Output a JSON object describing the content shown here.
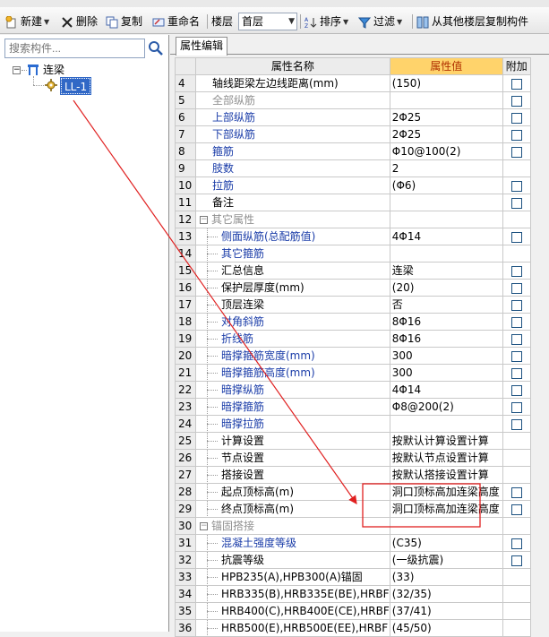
{
  "toolbar": {
    "items": [
      {
        "label": "新建",
        "icon": "new-icon"
      },
      {
        "label": "删除",
        "icon": "delete-icon"
      },
      {
        "label": "复制",
        "icon": "copy-icon"
      },
      {
        "label": "重命名",
        "icon": "rename-icon"
      },
      {
        "label": "楼层",
        "icon": ""
      },
      {
        "label": "排序",
        "icon": "sort-icon"
      },
      {
        "label": "过滤",
        "icon": "filter-icon"
      },
      {
        "label": "从其他楼层复制构件",
        "icon": "copy-floor-icon"
      }
    ],
    "floor_value": "首层"
  },
  "search": {
    "placeholder": "搜索构件..."
  },
  "tree": {
    "root": "连梁",
    "child": "LL-1"
  },
  "tab": {
    "label": "属性编辑"
  },
  "grid": {
    "headers": {
      "name": "属性名称",
      "value": "属性值",
      "extra": "附加"
    },
    "rows": [
      {
        "n": "4",
        "name": "轴线距梁左边线距离(mm)",
        "value": "(150)",
        "style": "normal",
        "indent": "1",
        "check": true
      },
      {
        "n": "5",
        "name": "全部纵筋",
        "value": "",
        "style": "gray",
        "indent": "1",
        "check": true
      },
      {
        "n": "6",
        "name": "上部纵筋",
        "value": "2Φ25",
        "style": "blue",
        "indent": "1",
        "check": true
      },
      {
        "n": "7",
        "name": "下部纵筋",
        "value": "2Φ25",
        "style": "blue",
        "indent": "1",
        "check": true
      },
      {
        "n": "8",
        "name": "箍筋",
        "value": "Φ10@100(2)",
        "style": "blue",
        "indent": "1",
        "check": true
      },
      {
        "n": "9",
        "name": "肢数",
        "value": "2",
        "style": "blue",
        "indent": "1",
        "check": false
      },
      {
        "n": "10",
        "name": "拉筋",
        "value": "(Φ6)",
        "style": "blue",
        "indent": "1",
        "check": true
      },
      {
        "n": "11",
        "name": "备注",
        "value": "",
        "style": "normal",
        "indent": "1",
        "check": true
      },
      {
        "n": "12",
        "name": "其它属性",
        "value": "",
        "style": "group",
        "indent": "0",
        "check": false
      },
      {
        "n": "13",
        "name": "侧面纵筋(总配筋值)",
        "value": "4Φ14",
        "style": "blue",
        "indent": "2",
        "check": true
      },
      {
        "n": "14",
        "name": "其它箍筋",
        "value": "",
        "style": "blue",
        "indent": "2",
        "check": false
      },
      {
        "n": "15",
        "name": "汇总信息",
        "value": "连梁",
        "style": "normal",
        "indent": "2",
        "check": true
      },
      {
        "n": "16",
        "name": "保护层厚度(mm)",
        "value": "(20)",
        "style": "normal",
        "indent": "2",
        "check": true
      },
      {
        "n": "17",
        "name": "顶层连梁",
        "value": "否",
        "style": "normal",
        "indent": "2",
        "check": true
      },
      {
        "n": "18",
        "name": "对角斜筋",
        "value": "8Φ16",
        "style": "blue",
        "indent": "2",
        "check": true
      },
      {
        "n": "19",
        "name": "折线筋",
        "value": "8Φ16",
        "style": "blue",
        "indent": "2",
        "check": true
      },
      {
        "n": "20",
        "name": "暗撑箍筋宽度(mm)",
        "value": "300",
        "style": "blue",
        "indent": "2",
        "check": true
      },
      {
        "n": "21",
        "name": "暗撑箍筋高度(mm)",
        "value": "300",
        "style": "blue",
        "indent": "2",
        "check": true
      },
      {
        "n": "22",
        "name": "暗撑纵筋",
        "value": "4Φ14",
        "style": "blue",
        "indent": "2",
        "check": true
      },
      {
        "n": "23",
        "name": "暗撑箍筋",
        "value": "Φ8@200(2)",
        "style": "blue",
        "indent": "2",
        "check": true
      },
      {
        "n": "24",
        "name": "暗撑拉筋",
        "value": "",
        "style": "blue",
        "indent": "2",
        "check": true
      },
      {
        "n": "25",
        "name": "计算设置",
        "value": "按默认计算设置计算",
        "style": "normal",
        "indent": "2",
        "check": false
      },
      {
        "n": "26",
        "name": "节点设置",
        "value": "按默认节点设置计算",
        "style": "normal",
        "indent": "2",
        "check": false
      },
      {
        "n": "27",
        "name": "搭接设置",
        "value": "按默认搭接设置计算",
        "style": "normal",
        "indent": "2",
        "check": false
      },
      {
        "n": "28",
        "name": "起点顶标高(m)",
        "value": "洞口顶标高加连梁高度",
        "style": "normal",
        "indent": "2",
        "check": true
      },
      {
        "n": "29",
        "name": "终点顶标高(m)",
        "value": "洞口顶标高加连梁高度",
        "style": "normal",
        "indent": "2",
        "check": true
      },
      {
        "n": "30",
        "name": "锚固搭接",
        "value": "",
        "style": "group",
        "indent": "0",
        "check": false
      },
      {
        "n": "31",
        "name": "混凝土强度等级",
        "value": "(C35)",
        "style": "blue",
        "indent": "2",
        "check": true
      },
      {
        "n": "32",
        "name": "抗震等级",
        "value": "(一级抗震)",
        "style": "normal",
        "indent": "2",
        "check": true
      },
      {
        "n": "33",
        "name": "HPB235(A),HPB300(A)锚固",
        "value": "(33)",
        "style": "normal",
        "indent": "2",
        "check": false
      },
      {
        "n": "34",
        "name": "HRB335(B),HRB335E(BE),HRBF",
        "value": "(32/35)",
        "style": "normal",
        "indent": "2",
        "check": false
      },
      {
        "n": "35",
        "name": "HRB400(C),HRB400E(CE),HRBF",
        "value": "(37/41)",
        "style": "normal",
        "indent": "2",
        "check": false
      },
      {
        "n": "36",
        "name": "HRB500(E),HRB500E(EE),HRBF",
        "value": "(45/50)",
        "style": "normal",
        "indent": "2",
        "check": false
      }
    ]
  },
  "colors": {
    "accent": "#3168c6",
    "header_value": "#ffd36b",
    "annotation": "#e02020",
    "link_text": "#1a3ca8"
  }
}
